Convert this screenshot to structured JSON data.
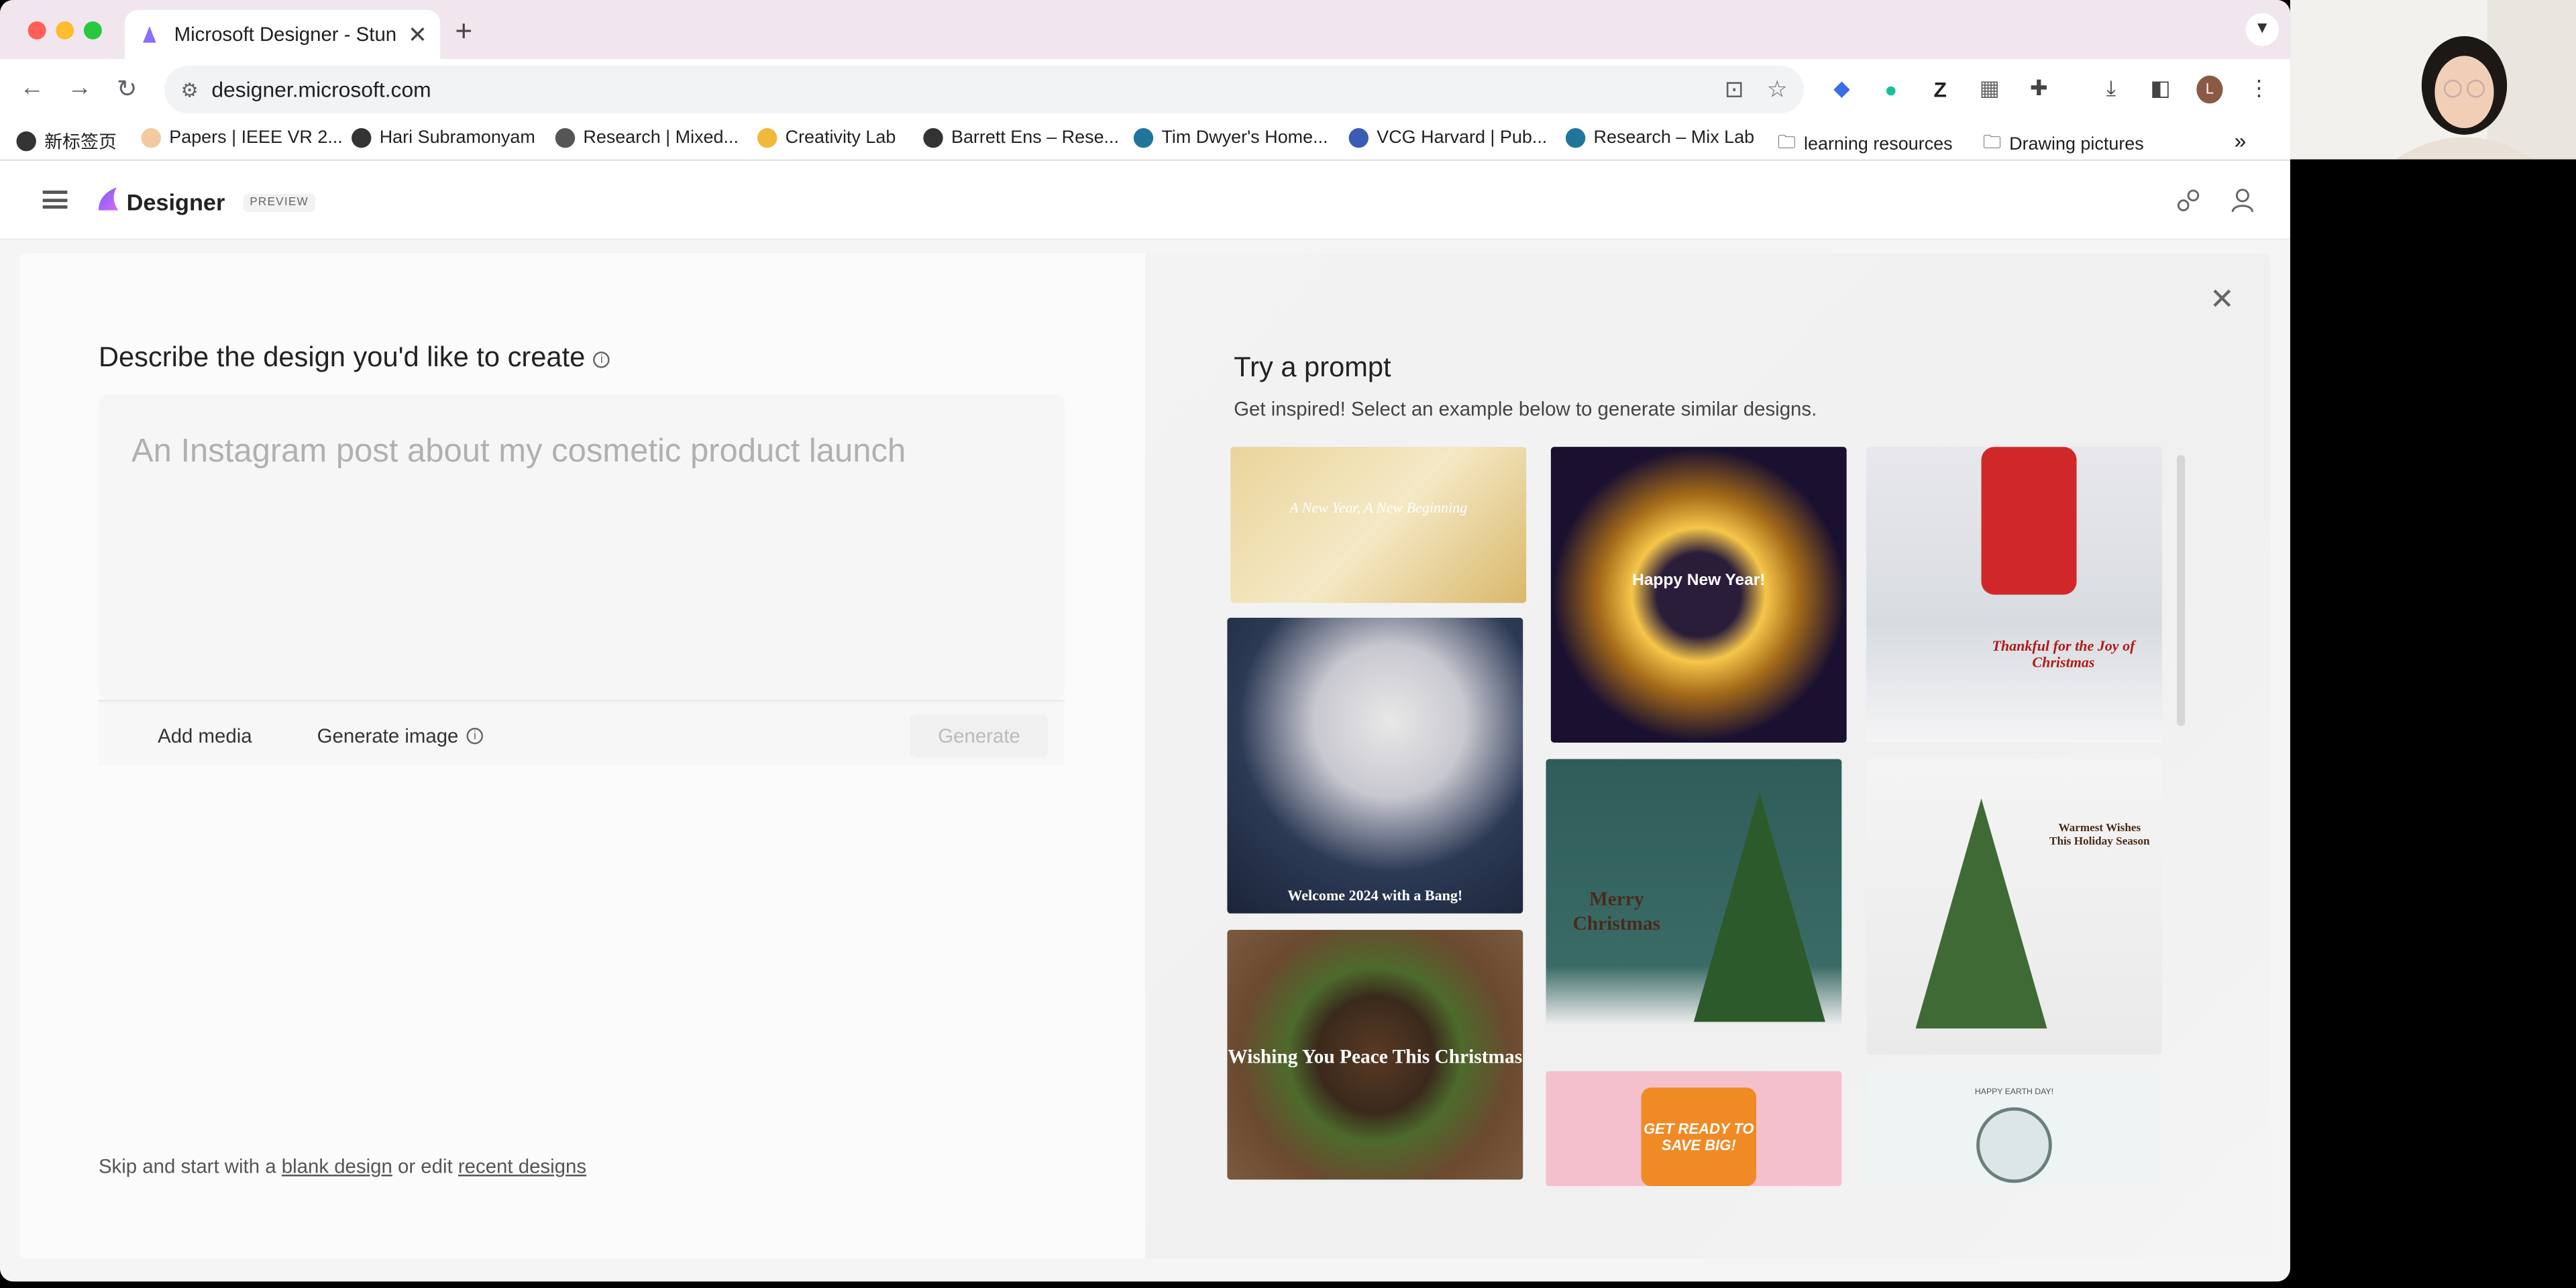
{
  "browser": {
    "tab_title": "Microsoft Designer - Stunning designs in a flash",
    "url": "designer.microsoft.com",
    "bookmarks": [
      "新标签页",
      "Papers | IEEE VR 2...",
      "Hari Subramonyam",
      "Research | Mixed...",
      "Creativity Lab",
      "Barrett Ens – Rese...",
      "Tim Dwyer's Home...",
      "VCG Harvard | Pub...",
      "Research – Mix Lab",
      "learning resources",
      "Drawing pictures"
    ],
    "profile_initial": "L"
  },
  "app": {
    "brand": "Designer",
    "badge": "PREVIEW"
  },
  "left": {
    "title": "Describe the design you'd like to create",
    "placeholder": "An Instagram post about my cosmetic product launch",
    "add_media": "Add media",
    "generate_image": "Generate image",
    "generate": "Generate",
    "skip_prefix": "Skip and start with a",
    "blank_design": "blank design",
    "skip_mid": "or edit",
    "recent_designs": "recent designs"
  },
  "right": {
    "title": "Try a prompt",
    "subtitle": "Get inspired! Select an example below to generate similar designs.",
    "examples": [
      {
        "caption": "A New Year, A New Beginning"
      },
      {
        "caption": "Happy New Year!"
      },
      {
        "caption": "Thankful for the Joy of Christmas"
      },
      {
        "caption": "Welcome 2024 with a Bang!"
      },
      {
        "caption": "Merry Christmas"
      },
      {
        "caption": "Warmest Wishes This Holiday Season"
      },
      {
        "caption": "Wishing You Peace This Christmas"
      },
      {
        "caption": "GET READY TO SAVE BIG!"
      },
      {
        "caption": "HAPPY EARTH DAY!"
      }
    ]
  },
  "colors": {
    "brand_gradient_start": "#7b5cff",
    "brand_gradient_end": "#d46cf0",
    "tabstrip": "#f1e6ee"
  }
}
